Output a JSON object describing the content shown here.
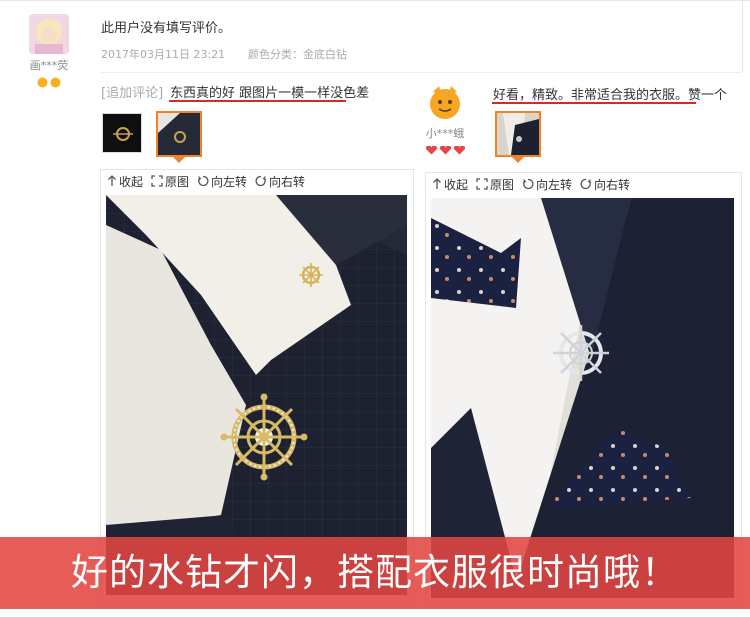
{
  "review1": {
    "username": "画***荧",
    "text": "此用户没有填写评价。",
    "date": "2017年03月11日 23:21",
    "attribute": "颜色分类：金底白钻"
  },
  "review2": {
    "append_label": "[追加评论]",
    "append_text": "东西真的好 跟图片一模一样没色差",
    "toolbar": {
      "collapse": "收起",
      "original": "原图",
      "rotate_left": "向左转",
      "rotate_right": "向右转"
    }
  },
  "review3": {
    "username": "小***蛾",
    "text": "好看，精致。非常适合我的衣服。赞一个",
    "toolbar": {
      "collapse": "收起",
      "original": "原图",
      "rotate_left": "向左转",
      "rotate_right": "向右转"
    }
  },
  "banner": {
    "text": "好的水钻才闪，搭配衣服很时尚哦！"
  },
  "colors": {
    "underline": "#d52a2a",
    "selected_border": "#f0822a",
    "banner": "#e24642"
  }
}
